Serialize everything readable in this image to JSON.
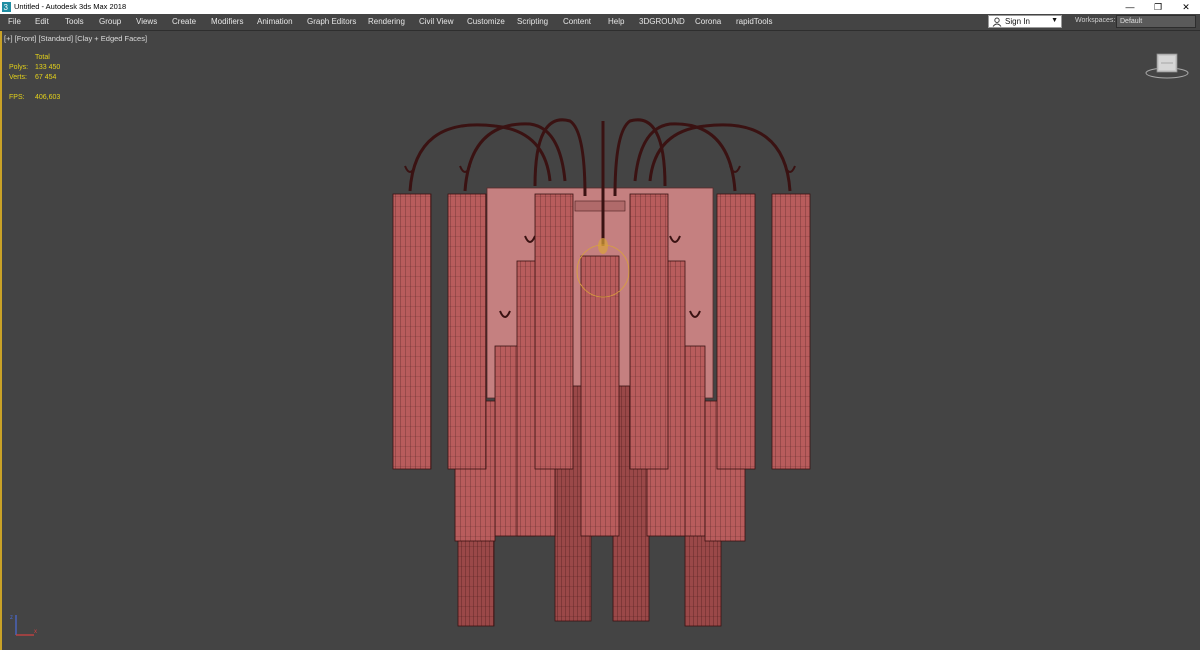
{
  "window": {
    "title": "Untitled - Autodesk 3ds Max 2018",
    "controls": {
      "minimize": "—",
      "restore": "❐",
      "close": "✕"
    }
  },
  "menubar": {
    "items": [
      "File",
      "Edit",
      "Tools",
      "Group",
      "Views",
      "Create",
      "Modifiers",
      "Animation",
      "Graph Editors",
      "Rendering",
      "Civil View",
      "Customize",
      "Scripting",
      "Content",
      "Help",
      "3DGROUND",
      "Corona",
      "rapidTools"
    ],
    "signin": {
      "label": "Sign In",
      "icon": "user-icon"
    },
    "workspaces": {
      "label": "Workspaces:",
      "value": "Default"
    }
  },
  "viewport": {
    "labels": [
      "[+]",
      "[Front]",
      "[Standard]",
      "[Clay + Edged Faces]"
    ],
    "stats": {
      "header": "Total",
      "polys_label": "Polys:",
      "polys": "133 450",
      "verts_label": "Verts:",
      "verts": "67 454",
      "fps_label": "FPS:",
      "fps": "406,603"
    },
    "colors": {
      "background": "#444444",
      "stats_text": "#e4d21a",
      "mesh_fill": "#b45a5a",
      "wire": "#3c1a1a",
      "active_border": "#c9a227"
    }
  }
}
